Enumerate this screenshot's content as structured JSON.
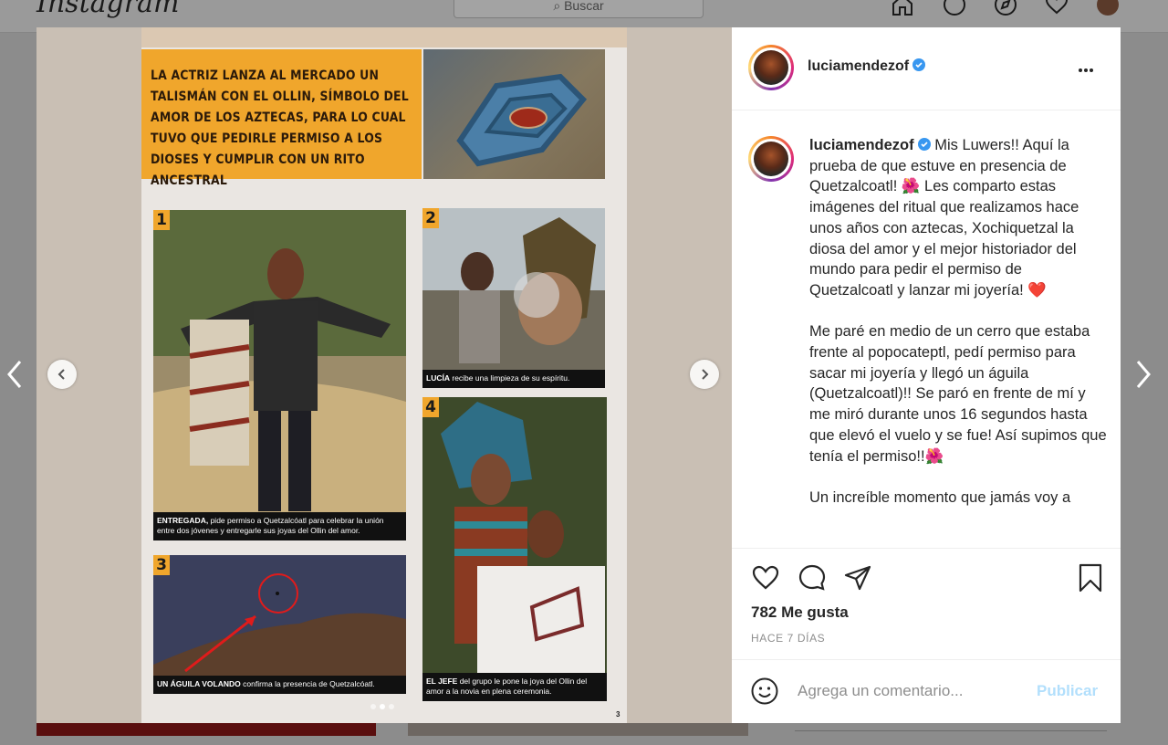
{
  "header": {
    "logo": "Instagram",
    "search_placeholder": "Buscar",
    "icons": [
      "home-icon",
      "messenger-icon",
      "explore-icon",
      "heart-icon",
      "profile-avatar"
    ]
  },
  "media": {
    "banner_text": "LA ACTRIZ LANZA AL MERCADO UN TALISMÁN CON EL OLLIN, SÍMBOLO DEL AMOR DE LOS AZTECAS, PARA LO CUAL TUVO QUE PEDIRLE PERMISO A LOS DIOSES Y CUMPLIR CON UN RITO ANCESTRAL",
    "panels": [
      {
        "num": "1",
        "cap_bold": "ENTREGADA,",
        "cap_text": "pide permiso a Quetzalcóatl para celebrar la unión entre dos jóvenes y entregarle sus joyas del Ollin del amor."
      },
      {
        "num": "2",
        "cap_bold": "LUCÍA",
        "cap_text": "recibe una limpieza de su espíritu."
      },
      {
        "num": "3",
        "cap_bold": "UN ÁGUILA VOLANDO",
        "cap_text": "confirma la presencia de Quetzalcóatl."
      },
      {
        "num": "4",
        "cap_bold": "EL JEFE",
        "cap_text": "del grupo le pone la joya del Ollin del amor a la novia en plena ceremonia."
      }
    ],
    "page_number": "3",
    "carousel_index": 2,
    "carousel_count": 3
  },
  "post": {
    "username": "luciamendezof",
    "caption_paragraphs": [
      "Mis Luwers!! Aquí la prueba de que estuve en presencia de Quetzalcoatl! 🌺 Les comparto estas imágenes del ritual que realizamos hace unos años con aztecas, Xochiquetzal la diosa del amor y el mejor historiador del mundo para pedir el permiso de Quetzalcoatl y lanzar mi joyería! ❤️",
      "Me paré en medio de un cerro que estaba frente al popocateptl, pedí permiso para sacar mi joyería y llegó un águila (Quetzalcoatl)!! Se paró en frente de mí y me miró durante unos 16 segundos hasta que elevó el vuelo y se fue! Así supimos que tenía el permiso!!🌺",
      "Un increíble momento que jamás voy a"
    ],
    "likes": "782 Me gusta",
    "time": "HACE 7 DÍAS",
    "comment_placeholder": "Agrega un comentario...",
    "publish_label": "Publicar",
    "colors": {
      "verified": "#3897f0",
      "publish": "#b2dffc",
      "banner": "#f0a62c"
    }
  }
}
